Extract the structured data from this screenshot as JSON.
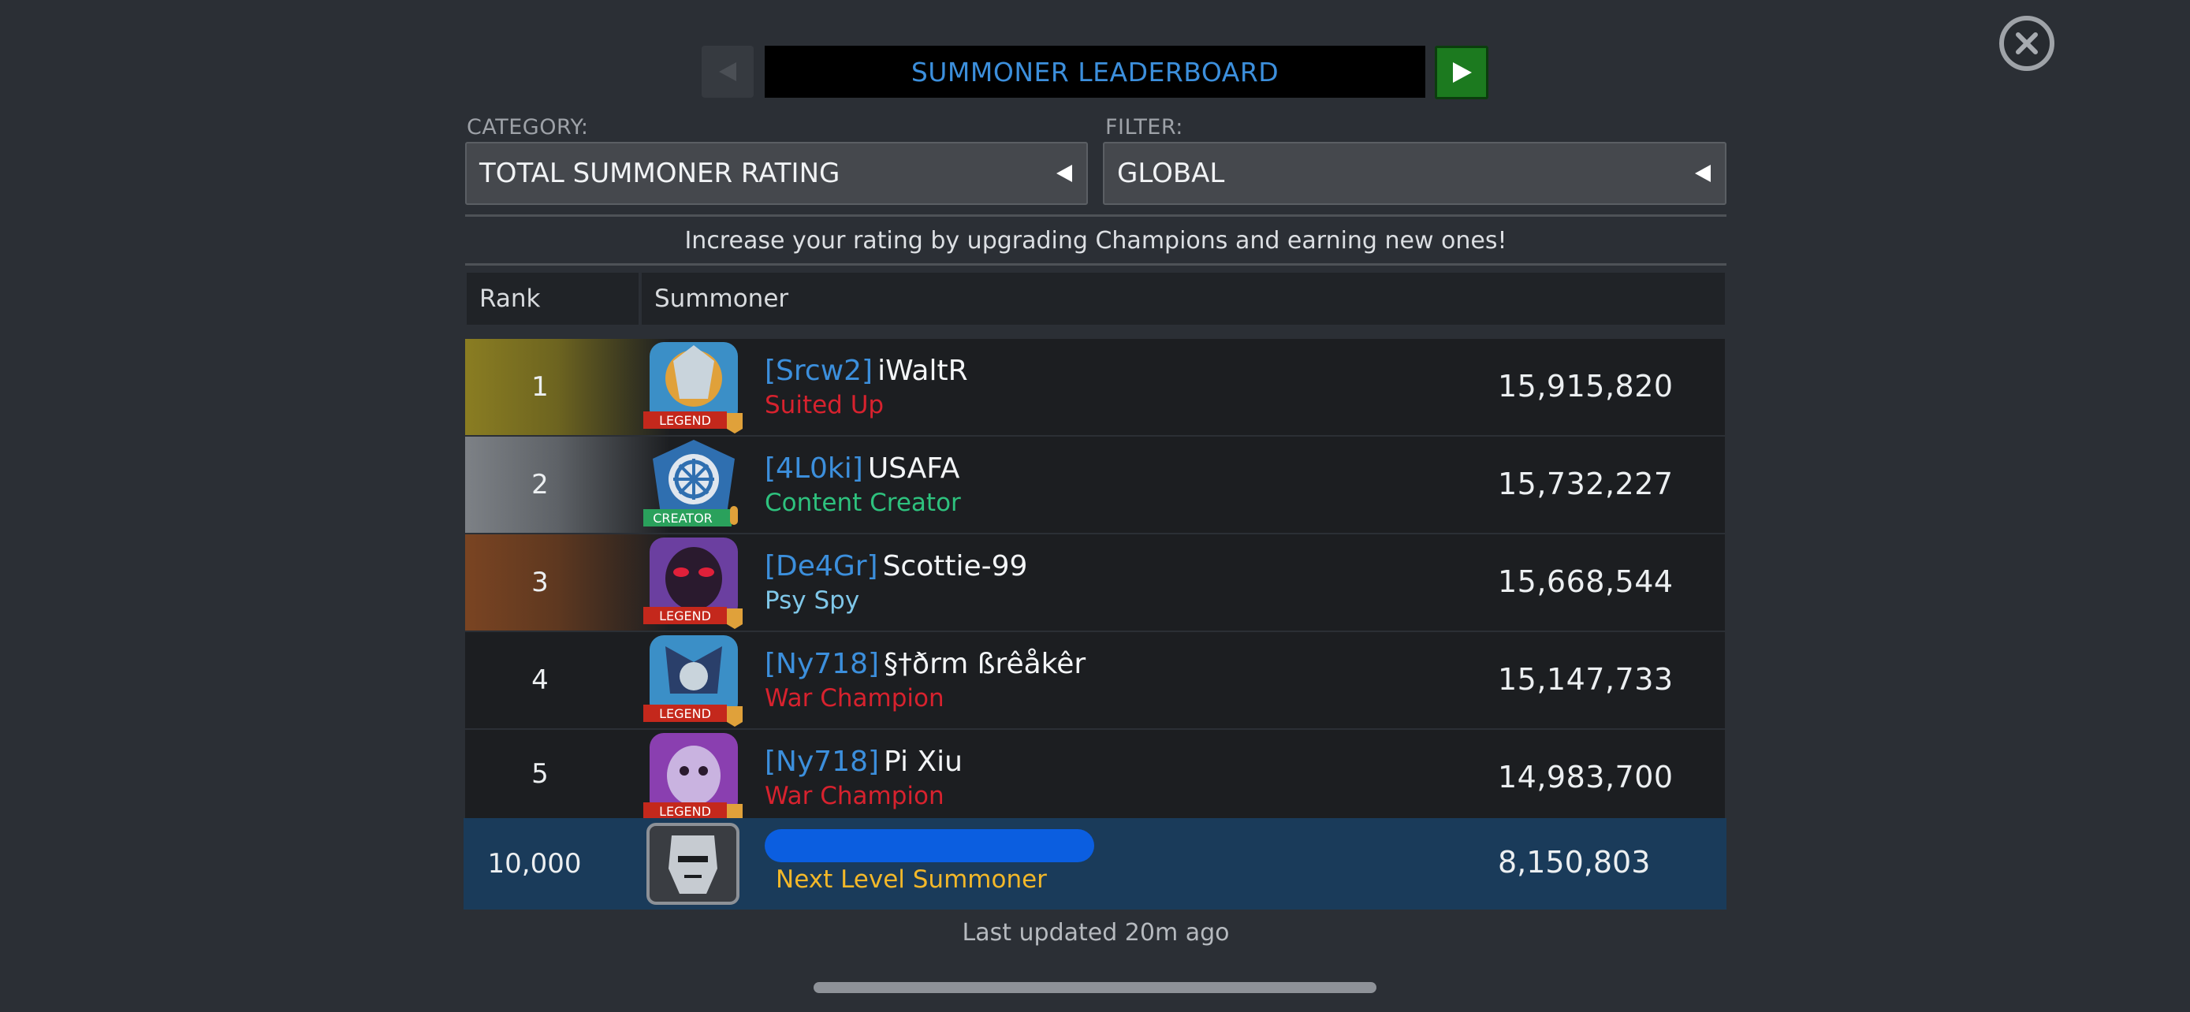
{
  "header": {
    "title": "SUMMONER LEADERBOARD",
    "prev_icon": "left-arrow-icon",
    "next_icon": "right-arrow-icon",
    "close_icon": "close-icon"
  },
  "category": {
    "label": "CATEGORY:",
    "value": "TOTAL SUMMONER RATING"
  },
  "filter": {
    "label": "FILTER:",
    "value": "GLOBAL"
  },
  "info": "Increase your rating by upgrading Champions and earning new ones!",
  "table": {
    "columns": [
      "Rank",
      "Summoner"
    ],
    "rows": [
      {
        "rank": "1",
        "alliance": "[Srcw2]",
        "name": "iWaltR",
        "title": "Suited Up",
        "title_color": "#d7222e",
        "badge": "LEGEND",
        "score": "15,915,820"
      },
      {
        "rank": "2",
        "alliance": "[4L0ki]",
        "name": "USAFA",
        "title": "Content Creator",
        "title_color": "#2ec27e",
        "badge": "CREATOR",
        "score": "15,732,227"
      },
      {
        "rank": "3",
        "alliance": "[De4Gr]",
        "name": "Scottie-99",
        "title": "Psy Spy",
        "title_color": "#7fc7e8",
        "badge": "LEGEND",
        "score": "15,668,544"
      },
      {
        "rank": "4",
        "alliance": "[Ny718]",
        "name": "§†ðrm ßrêåkêr",
        "title": "War Champion",
        "title_color": "#d7222e",
        "badge": "LEGEND",
        "score": "15,147,733"
      },
      {
        "rank": "5",
        "alliance": "[Ny718]",
        "name": "Pi Xiu",
        "title": "War Champion",
        "title_color": "#d7222e",
        "badge": "LEGEND",
        "score": "14,983,700"
      }
    ]
  },
  "self": {
    "rank": "10,000",
    "title": "Next Level Summoner",
    "score": "8,150,803"
  },
  "footer": {
    "last_updated": "Last updated 20m ago"
  }
}
